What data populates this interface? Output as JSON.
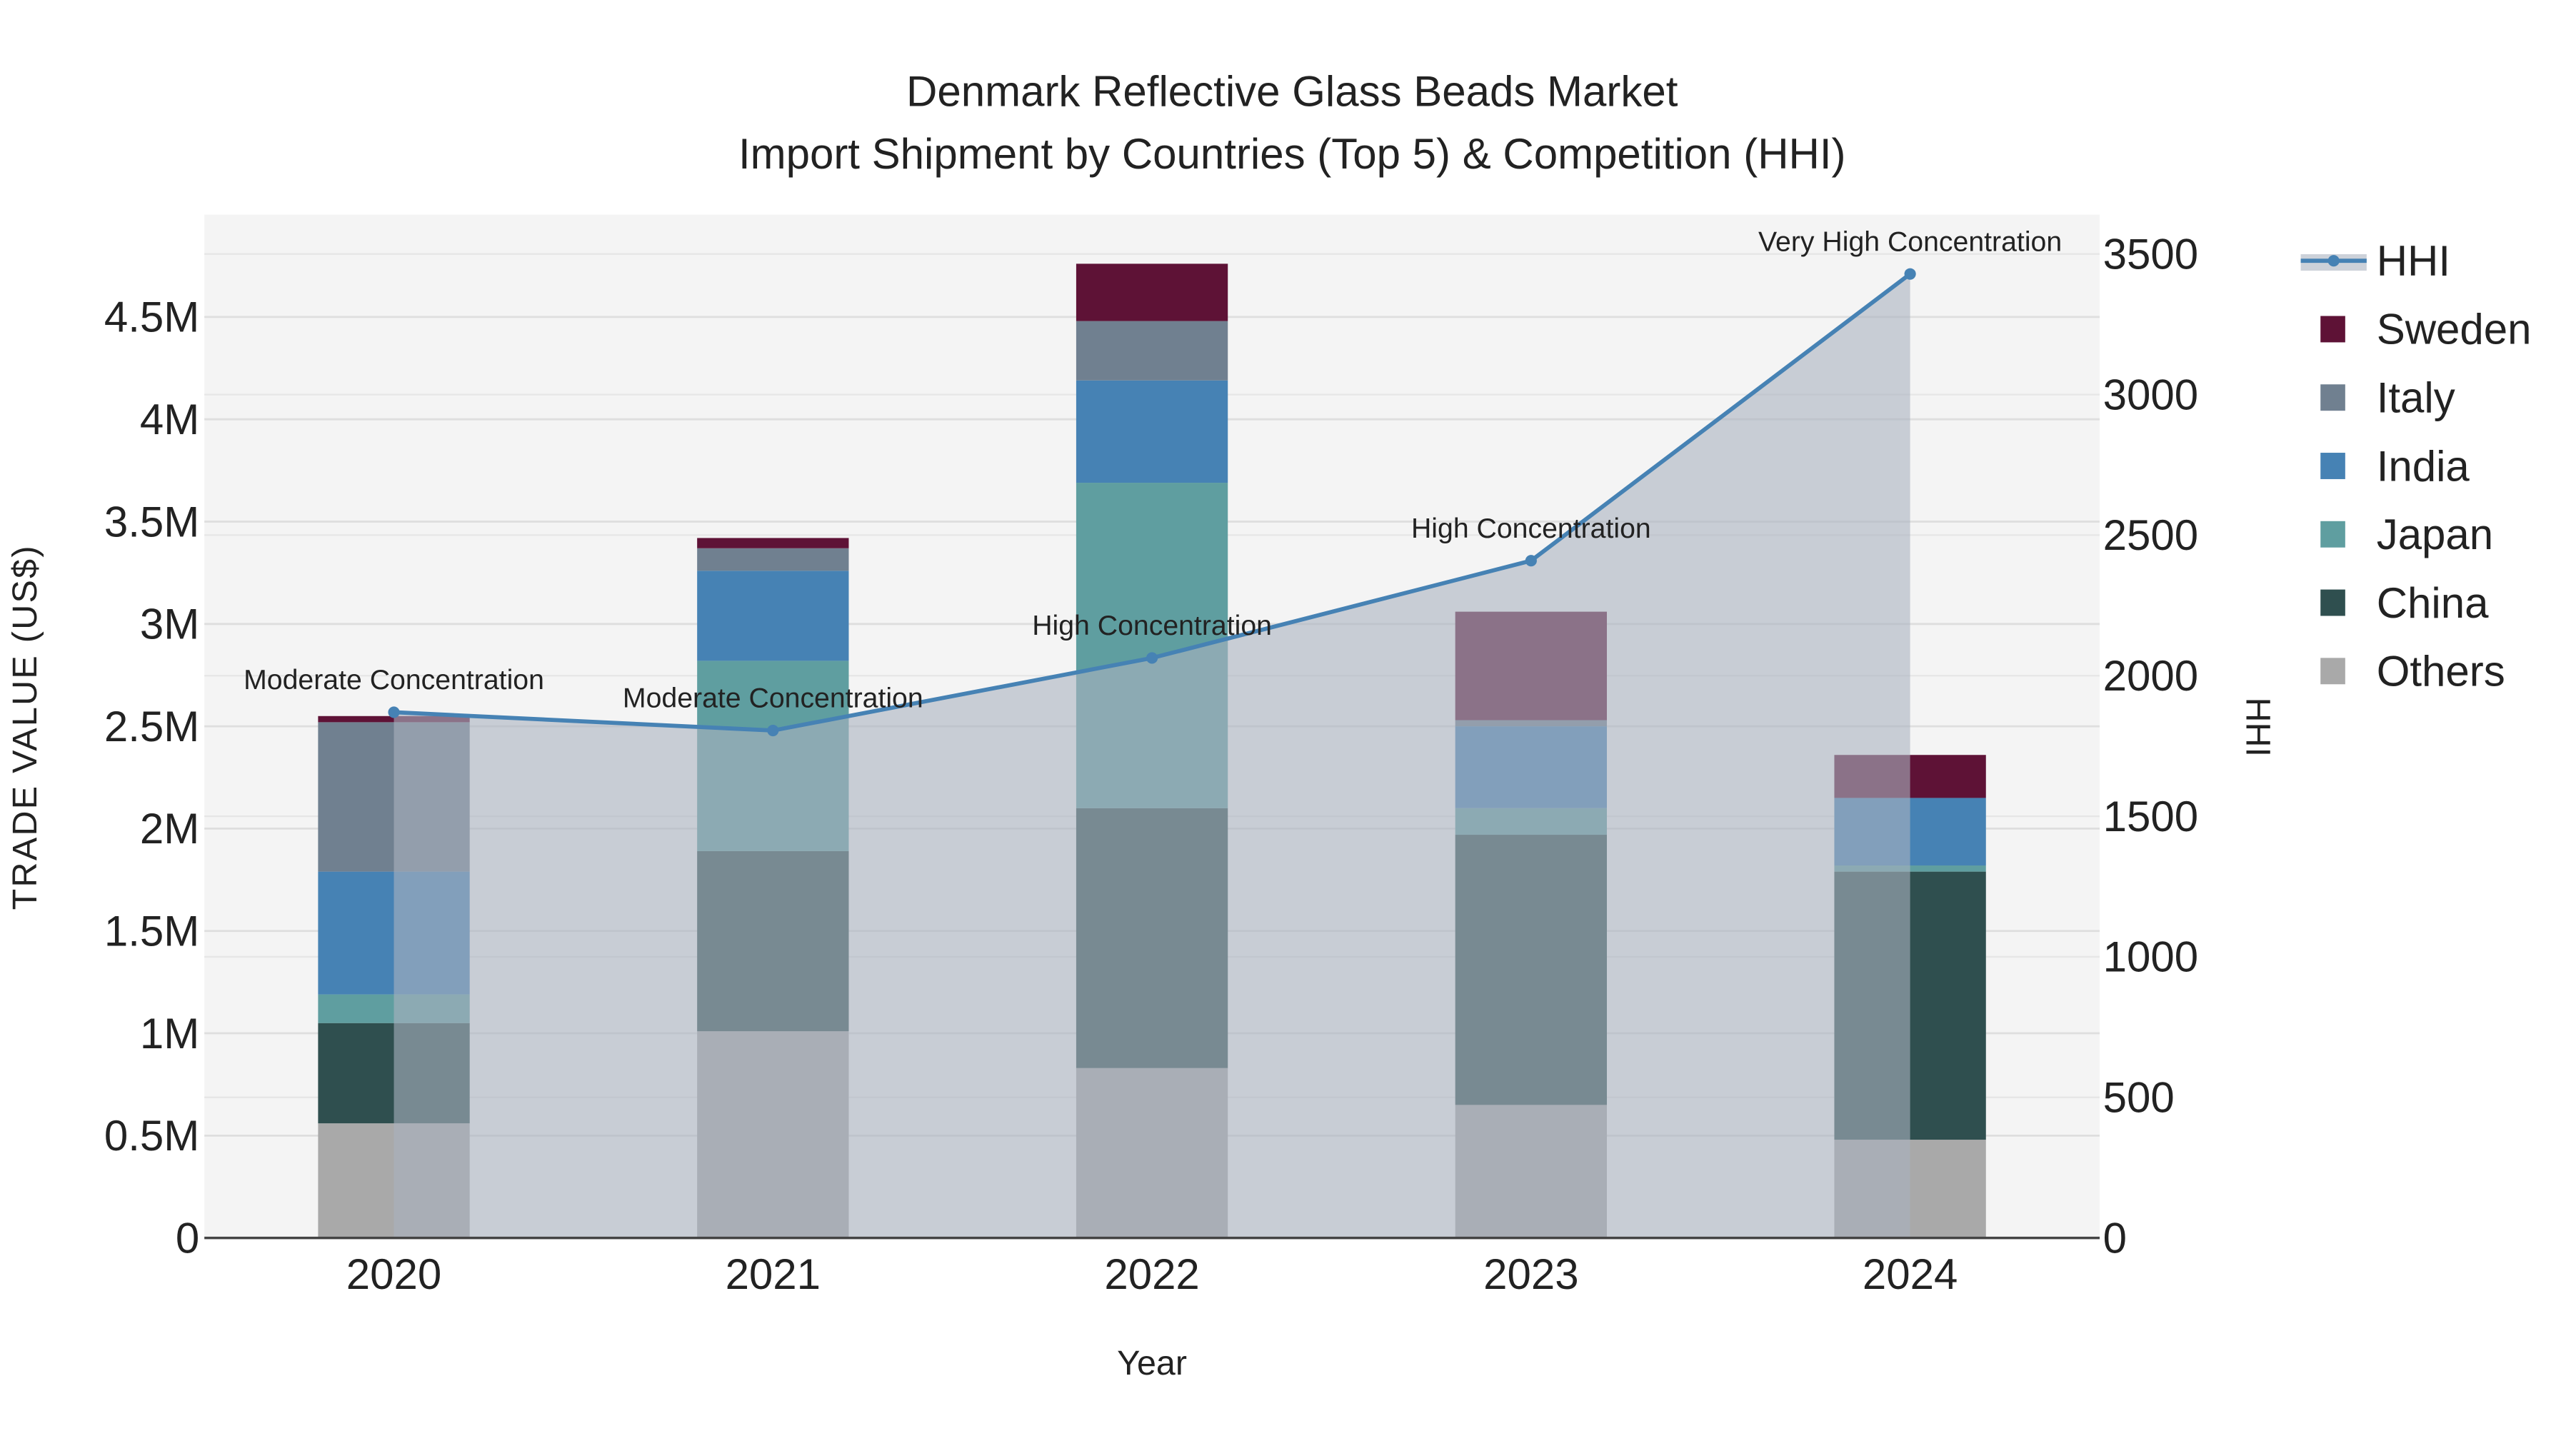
{
  "chart_data": {
    "type": "bar",
    "stacked": true,
    "title": "Denmark Reflective Glass Beads Market",
    "subtitle": "Import Shipment by Countries (Top 5) & Competition (HHI)",
    "xlabel": "Year",
    "ylabel": "TRADE VALUE (US$)",
    "y2label": "HHI",
    "categories": [
      "2020",
      "2021",
      "2022",
      "2023",
      "2024"
    ],
    "ylim": [
      0,
      5000000
    ],
    "y2lim": [
      0,
      3640
    ],
    "yticks": [
      0,
      500000,
      1000000,
      1500000,
      2000000,
      2500000,
      3000000,
      3500000,
      4000000,
      4500000
    ],
    "ytick_labels": [
      "0",
      "0.5M",
      "1M",
      "1.5M",
      "2M",
      "2.5M",
      "3M",
      "3.5M",
      "4M",
      "4.5M"
    ],
    "y2ticks": [
      0,
      500,
      1000,
      1500,
      2000,
      2500,
      3000,
      3500
    ],
    "y2tick_labels": [
      "0",
      "500",
      "1000",
      "1500",
      "2000",
      "2500",
      "3000",
      "3500"
    ],
    "series": [
      {
        "name": "Others",
        "color": "#a9a9a9",
        "values": [
          560000,
          1010000,
          830000,
          650000,
          480000
        ]
      },
      {
        "name": "China",
        "color": "#2f4f4f",
        "values": [
          490000,
          880000,
          1270000,
          1320000,
          1310000
        ]
      },
      {
        "name": "Japan",
        "color": "#5f9ea0",
        "values": [
          140000,
          930000,
          1590000,
          130000,
          30000
        ]
      },
      {
        "name": "India",
        "color": "#4682b4",
        "values": [
          600000,
          440000,
          500000,
          400000,
          330000
        ]
      },
      {
        "name": "Italy",
        "color": "#708090",
        "values": [
          730000,
          110000,
          290000,
          30000,
          0
        ]
      },
      {
        "name": "Sweden",
        "color": "#5e1236",
        "values": [
          30000,
          50000,
          280000,
          530000,
          210000
        ]
      }
    ],
    "line": {
      "name": "HHI",
      "color": "#4682b4",
      "axis": "y2",
      "values": [
        1870,
        1805,
        2063,
        2409,
        3429
      ],
      "annotations": [
        "Moderate Concentration",
        "Moderate Concentration",
        "High Concentration",
        "High Concentration",
        "Very High Concentration"
      ]
    },
    "legend_order": [
      "HHI",
      "Sweden",
      "Italy",
      "India",
      "Japan",
      "China",
      "Others"
    ],
    "legend_position": "right",
    "grid": true
  }
}
